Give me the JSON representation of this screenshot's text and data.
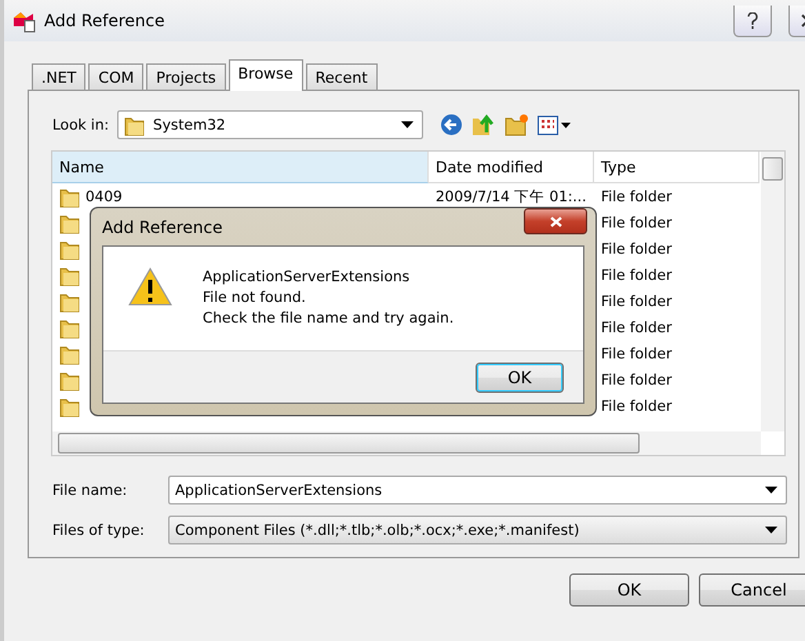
{
  "window": {
    "title": "Add Reference"
  },
  "tabs": [
    {
      "label": ".NET",
      "selected": false
    },
    {
      "label": "COM",
      "selected": false
    },
    {
      "label": "Projects",
      "selected": false
    },
    {
      "label": "Browse",
      "selected": true
    },
    {
      "label": "Recent",
      "selected": false
    }
  ],
  "look_in": {
    "label": "Look in:",
    "value": "System32"
  },
  "file_list": {
    "columns": [
      "Name",
      "Date modified",
      "Type"
    ],
    "rows": [
      {
        "name": "0409",
        "date": "2009/7/14 下午 01:...",
        "type": "File folder"
      },
      {
        "type": "File folder"
      },
      {
        "type": "File folder"
      },
      {
        "type": "File folder"
      },
      {
        "type": "File folder"
      },
      {
        "type": "File folder"
      },
      {
        "type": "File folder"
      },
      {
        "type": "File folder"
      },
      {
        "type": "File folder"
      }
    ]
  },
  "file_name": {
    "label": "File name:",
    "value": "ApplicationServerExtensions"
  },
  "file_type": {
    "label": "Files of type:",
    "value": "Component Files (*.dll;*.tlb;*.olb;*.ocx;*.exe;*.manifest)"
  },
  "buttons": [
    "OK",
    "Cancel"
  ],
  "message_box": {
    "title": "Add Reference",
    "lines": [
      "ApplicationServerExtensions",
      "File not found.",
      "Check the file name and try again."
    ],
    "button": "OK"
  }
}
